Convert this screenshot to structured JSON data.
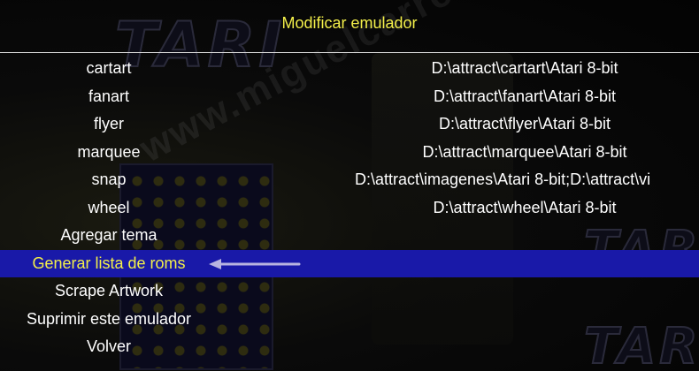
{
  "header": {
    "title": "Modificar emulador"
  },
  "menu": {
    "items": [
      {
        "label": "cartart",
        "value": "D:\\attract\\cartart\\Atari 8-bit"
      },
      {
        "label": "fanart",
        "value": "D:\\attract\\fanart\\Atari 8-bit"
      },
      {
        "label": "flyer",
        "value": "D:\\attract\\flyer\\Atari 8-bit"
      },
      {
        "label": "marquee",
        "value": "D:\\attract\\marquee\\Atari 8-bit"
      },
      {
        "label": "snap",
        "value": "D:\\attract\\imagenes\\Atari 8-bit;D:\\attract\\vi"
      },
      {
        "label": "wheel",
        "value": "D:\\attract\\wheel\\Atari 8-bit"
      },
      {
        "label": "Agregar tema"
      },
      {
        "label": "Generar lista de roms",
        "selected": true
      },
      {
        "label": "Scrape Artwork"
      },
      {
        "label": "Suprimir este emulador"
      },
      {
        "label": "Volver"
      }
    ]
  },
  "colors": {
    "title": "#f3ef4a",
    "selection_bg": "#1919a8",
    "selected_text": "#f3ef4a",
    "text": "#ffffff",
    "arrow": "#b8b4e0"
  },
  "watermark": {
    "text": "www.miguelcarreras.com"
  },
  "icons": {
    "selection_pointer": "left-arrow-icon"
  }
}
